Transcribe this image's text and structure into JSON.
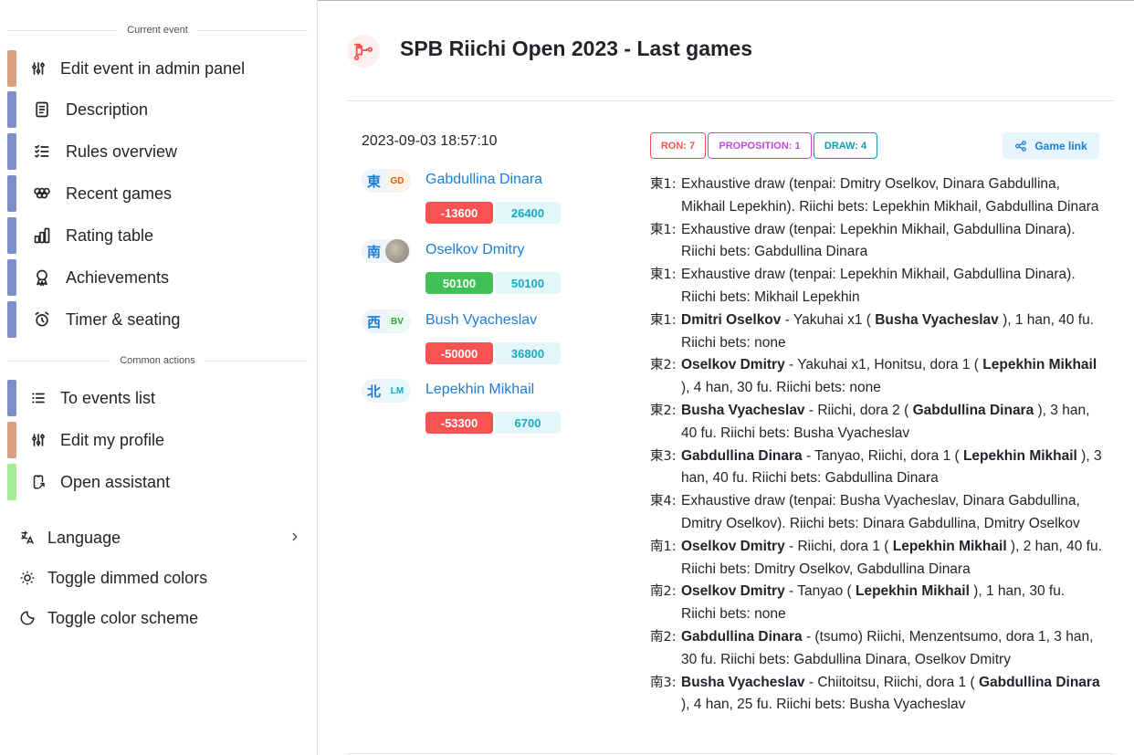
{
  "sidebar": {
    "current_event_label": "Current event",
    "event_items": [
      {
        "label": "Edit event in admin panel",
        "icon": "sliders-icon",
        "color": "#d9a082"
      },
      {
        "label": "Description",
        "icon": "file-text-icon",
        "color": "#7e8fc8"
      },
      {
        "label": "Rules overview",
        "icon": "checklist-icon",
        "color": "#7e8fc8"
      },
      {
        "label": "Recent games",
        "icon": "olympic-rings-icon",
        "color": "#7e8fc8"
      },
      {
        "label": "Rating table",
        "icon": "chart-bar-icon",
        "color": "#7e8fc8"
      },
      {
        "label": "Achievements",
        "icon": "award-icon",
        "color": "#7e8fc8"
      },
      {
        "label": "Timer & seating",
        "icon": "alarm-icon",
        "color": "#7e8fc8"
      }
    ],
    "common_actions_label": "Common actions",
    "common_items": [
      {
        "label": "To events list",
        "icon": "list-icon",
        "color": "#7e8fc8"
      },
      {
        "label": "Edit my profile",
        "icon": "sliders-icon",
        "color": "#d9a082"
      },
      {
        "label": "Open assistant",
        "icon": "device-mobile-share-icon",
        "color": "#a6ec9a"
      }
    ],
    "settings": {
      "language": "Language",
      "dimmed": "Toggle dimmed colors",
      "scheme": "Toggle color scheme"
    }
  },
  "header": {
    "title": "SPB Riichi Open 2023 - Last games",
    "icon": "tournament-bracket-icon"
  },
  "game": {
    "date": "2023-09-03 18:57:10",
    "badges": {
      "ron": "RON: 7",
      "proposition": "PROPOSITION: 1",
      "draw": "DRAW: 4"
    },
    "game_link": "Game link",
    "players": [
      {
        "wind": "東",
        "initials": "GD",
        "name": "Gabdullina Dinara",
        "delta": "-13600",
        "score": "26400",
        "initials_color": "#e8590c",
        "initials_bg": "#fff4e6"
      },
      {
        "wind": "南",
        "initials": "",
        "name": "Oselkov Dmitry",
        "delta": "50100",
        "score": "50100"
      },
      {
        "wind": "西",
        "initials": "BV",
        "name": "Bush Vyacheslav",
        "delta": "-50000",
        "score": "36800",
        "initials_color": "#2f9e44",
        "initials_bg": "#ebfbee"
      },
      {
        "wind": "北",
        "initials": "LM",
        "name": "Lepekhin Mikhail",
        "delta": "-53300",
        "score": "6700",
        "initials_color": "#15aabf",
        "initials_bg": "#e3fafc"
      }
    ],
    "rounds": [
      {
        "label": "東1:",
        "parts": [
          {
            "t": "Exhaustive draw (tenpai: Dmitry Oselkov, Dinara Gabdullina, Mikhail Lepekhin). Riichi bets: Lepekhin Mikhail, Gabdullina Dinara"
          }
        ]
      },
      {
        "label": "東1:",
        "parts": [
          {
            "t": "Exhaustive draw (tenpai: Lepekhin Mikhail, Gabdullina Dinara). Riichi bets: Gabdullina Dinara"
          }
        ]
      },
      {
        "label": "東1:",
        "parts": [
          {
            "t": "Exhaustive draw (tenpai: Lepekhin Mikhail, Gabdullina Dinara). Riichi bets: Mikhail Lepekhin"
          }
        ]
      },
      {
        "label": "東1:",
        "parts": [
          {
            "b": "Dmitri Oselkov"
          },
          {
            "t": " - Yakuhai x1 ( "
          },
          {
            "b": "Busha Vyacheslav"
          },
          {
            "t": " ), 1 han, 40 fu. Riichi bets: none"
          }
        ]
      },
      {
        "label": "東2:",
        "parts": [
          {
            "b": "Oselkov Dmitry"
          },
          {
            "t": " - Yakuhai x1, Honitsu, dora 1 ( "
          },
          {
            "b": "Lepekhin Mikhail"
          },
          {
            "t": " ), 4 han, 30 fu. Riichi bets: none"
          }
        ]
      },
      {
        "label": "東2:",
        "parts": [
          {
            "b": "Busha Vyacheslav"
          },
          {
            "t": " - Riichi, dora 2 ( "
          },
          {
            "b": "Gabdullina Dinara"
          },
          {
            "t": " ), 3 han, 40 fu. Riichi bets: Busha Vyacheslav"
          }
        ]
      },
      {
        "label": "東3:",
        "parts": [
          {
            "b": "Gabdullina Dinara"
          },
          {
            "t": " - Tanyao, Riichi, dora 1 ( "
          },
          {
            "b": "Lepekhin Mikhail"
          },
          {
            "t": " ), 3 han, 40 fu. Riichi bets: Gabdullina Dinara"
          }
        ]
      },
      {
        "label": "東4:",
        "parts": [
          {
            "t": "Exhaustive draw (tenpai: Busha Vyacheslav, Dinara Gabdullina, Dmitry Oselkov). Riichi bets: Dinara Gabdullina, Dmitry Oselkov"
          }
        ]
      },
      {
        "label": "南1:",
        "parts": [
          {
            "b": "Oselkov Dmitry"
          },
          {
            "t": " - Riichi, dora 1 ( "
          },
          {
            "b": "Lepekhin Mikhail"
          },
          {
            "t": " ), 2 han, 40 fu. Riichi bets: Dmitry Oselkov, Gabdullina Dinara"
          }
        ]
      },
      {
        "label": "南2:",
        "parts": [
          {
            "b": "Oselkov Dmitry"
          },
          {
            "t": " - Tanyao ( "
          },
          {
            "b": "Lepekhin Mikhail"
          },
          {
            "t": " ), 1 han, 30 fu. Riichi bets: none"
          }
        ]
      },
      {
        "label": "南2:",
        "parts": [
          {
            "b": "Gabdullina Dinara"
          },
          {
            "t": " - (tsumo) Riichi, Menzentsumo, dora 1, 3 han, 30 fu. Riichi bets: Gabdullina Dinara, Oselkov Dmitry"
          }
        ]
      },
      {
        "label": "南3:",
        "parts": [
          {
            "b": "Busha Vyacheslav"
          },
          {
            "t": " - Chiitoitsu, Riichi, dora 1 ( "
          },
          {
            "b": "Gabdullina Dinara"
          },
          {
            "t": " ), 4 han, 25 fu. Riichi bets: Busha Vyacheslav"
          }
        ]
      }
    ]
  }
}
